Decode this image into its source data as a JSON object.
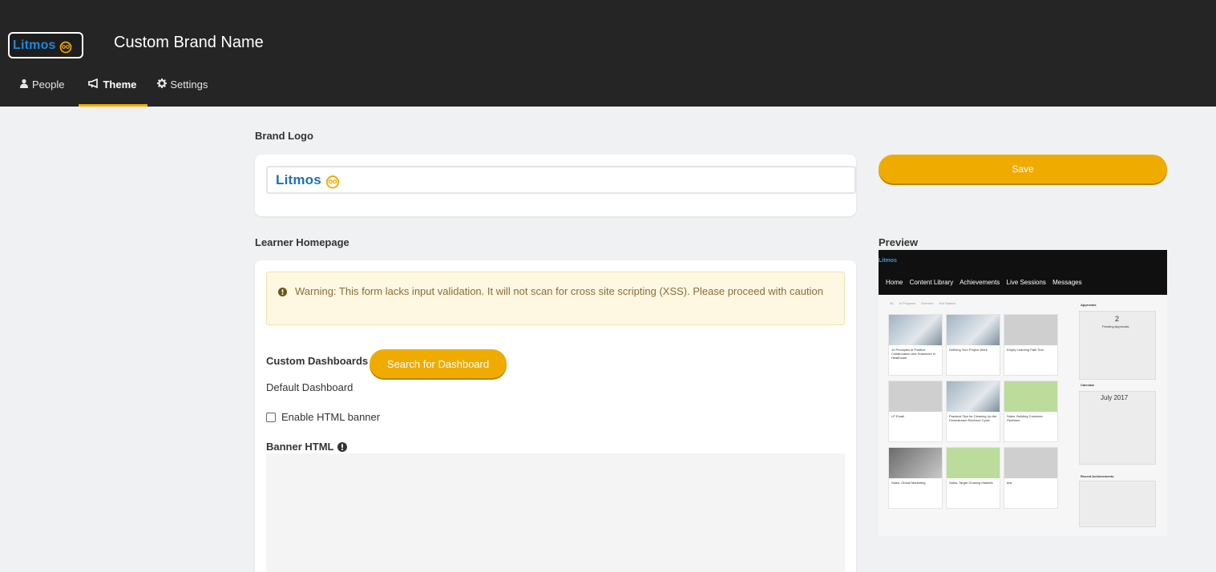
{
  "header": {
    "logo_text": "Litmos",
    "brand_name": "Custom Brand Name",
    "tabs": [
      {
        "label": "People",
        "icon": "user-icon",
        "active": false
      },
      {
        "label": "Theme",
        "icon": "megaphone-icon",
        "active": true
      },
      {
        "label": "Settings",
        "icon": "gear-icon",
        "active": false
      }
    ]
  },
  "brand_logo": {
    "section_title": "Brand Logo",
    "logo_text": "Litmos"
  },
  "save_label": "Save",
  "learner_homepage": {
    "section_title": "Learner Homepage",
    "warning": "Warning: This form lacks input validation. It will not scan for cross site scripting (XSS). Please proceed with caution",
    "custom_dashboards_label": "Custom Dashboards",
    "search_button": "Search for Dashboard",
    "default_dashboard": "Default Dashboard",
    "enable_banner_label": "Enable HTML banner",
    "enable_banner_checked": false,
    "banner_html_label": "Banner HTML"
  },
  "preview": {
    "title": "Preview",
    "logo_text": "Litmos",
    "nav": [
      "Home",
      "Content Library",
      "Achievements",
      "Live Sessions",
      "Messages"
    ],
    "filters": [
      "All",
      "In Progress",
      "Overdue",
      "Not Started"
    ],
    "tiles": [
      "10 Principles of Positive Collaboration and Teamwork in Healthcare",
      "Defining Your Project Work",
      "Empty Learning Path Test",
      "LP Email",
      "Practical Tips for Cleaning Up the Downstream Revenue Cycle",
      "Sales: Building Customer Pipelines",
      "Sales: Global Marketing",
      "Sales: Target Growing Markets",
      "test"
    ],
    "approvals_title": "Approvals",
    "approvals_count": "2",
    "approvals_caption": "Pending Approvals",
    "calendar_title": "Calendar",
    "calendar_month": "July 2017",
    "achievements_title": "Recent Achievements"
  },
  "colors": {
    "header_bg": "#252525",
    "accent": "#f0ab00",
    "logo_blue": "#1e88d8",
    "warning_bg": "#fef7e1",
    "page_bg": "#f0f1f2"
  }
}
